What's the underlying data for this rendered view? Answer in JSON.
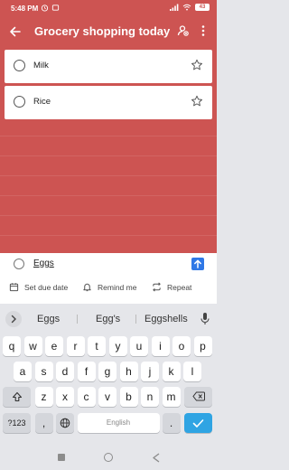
{
  "status_bar": {
    "time": "5:48 PM",
    "battery": "43"
  },
  "app_bar": {
    "title": "Grocery shopping today"
  },
  "tasks": [
    {
      "label": "Milk"
    },
    {
      "label": "Rice"
    }
  ],
  "composer": {
    "value": "Eggs",
    "options": [
      "Set due date",
      "Remind me",
      "Repeat"
    ]
  },
  "keyboard": {
    "suggestions": [
      "Eggs",
      "Egg's",
      "Eggshells"
    ],
    "row1": [
      "q",
      "w",
      "e",
      "r",
      "t",
      "y",
      "u",
      "i",
      "o",
      "p"
    ],
    "row2": [
      "a",
      "s",
      "d",
      "f",
      "g",
      "h",
      "j",
      "k",
      "l"
    ],
    "row3": [
      "z",
      "x",
      "c",
      "v",
      "b",
      "n",
      "m"
    ],
    "symbols_label": "?123",
    "comma": ",",
    "space_label": "English",
    "period": "."
  },
  "colors": {
    "list_bg": "#cd5452",
    "accent": "#2f78e6",
    "enter_key": "#2fa4e3"
  }
}
